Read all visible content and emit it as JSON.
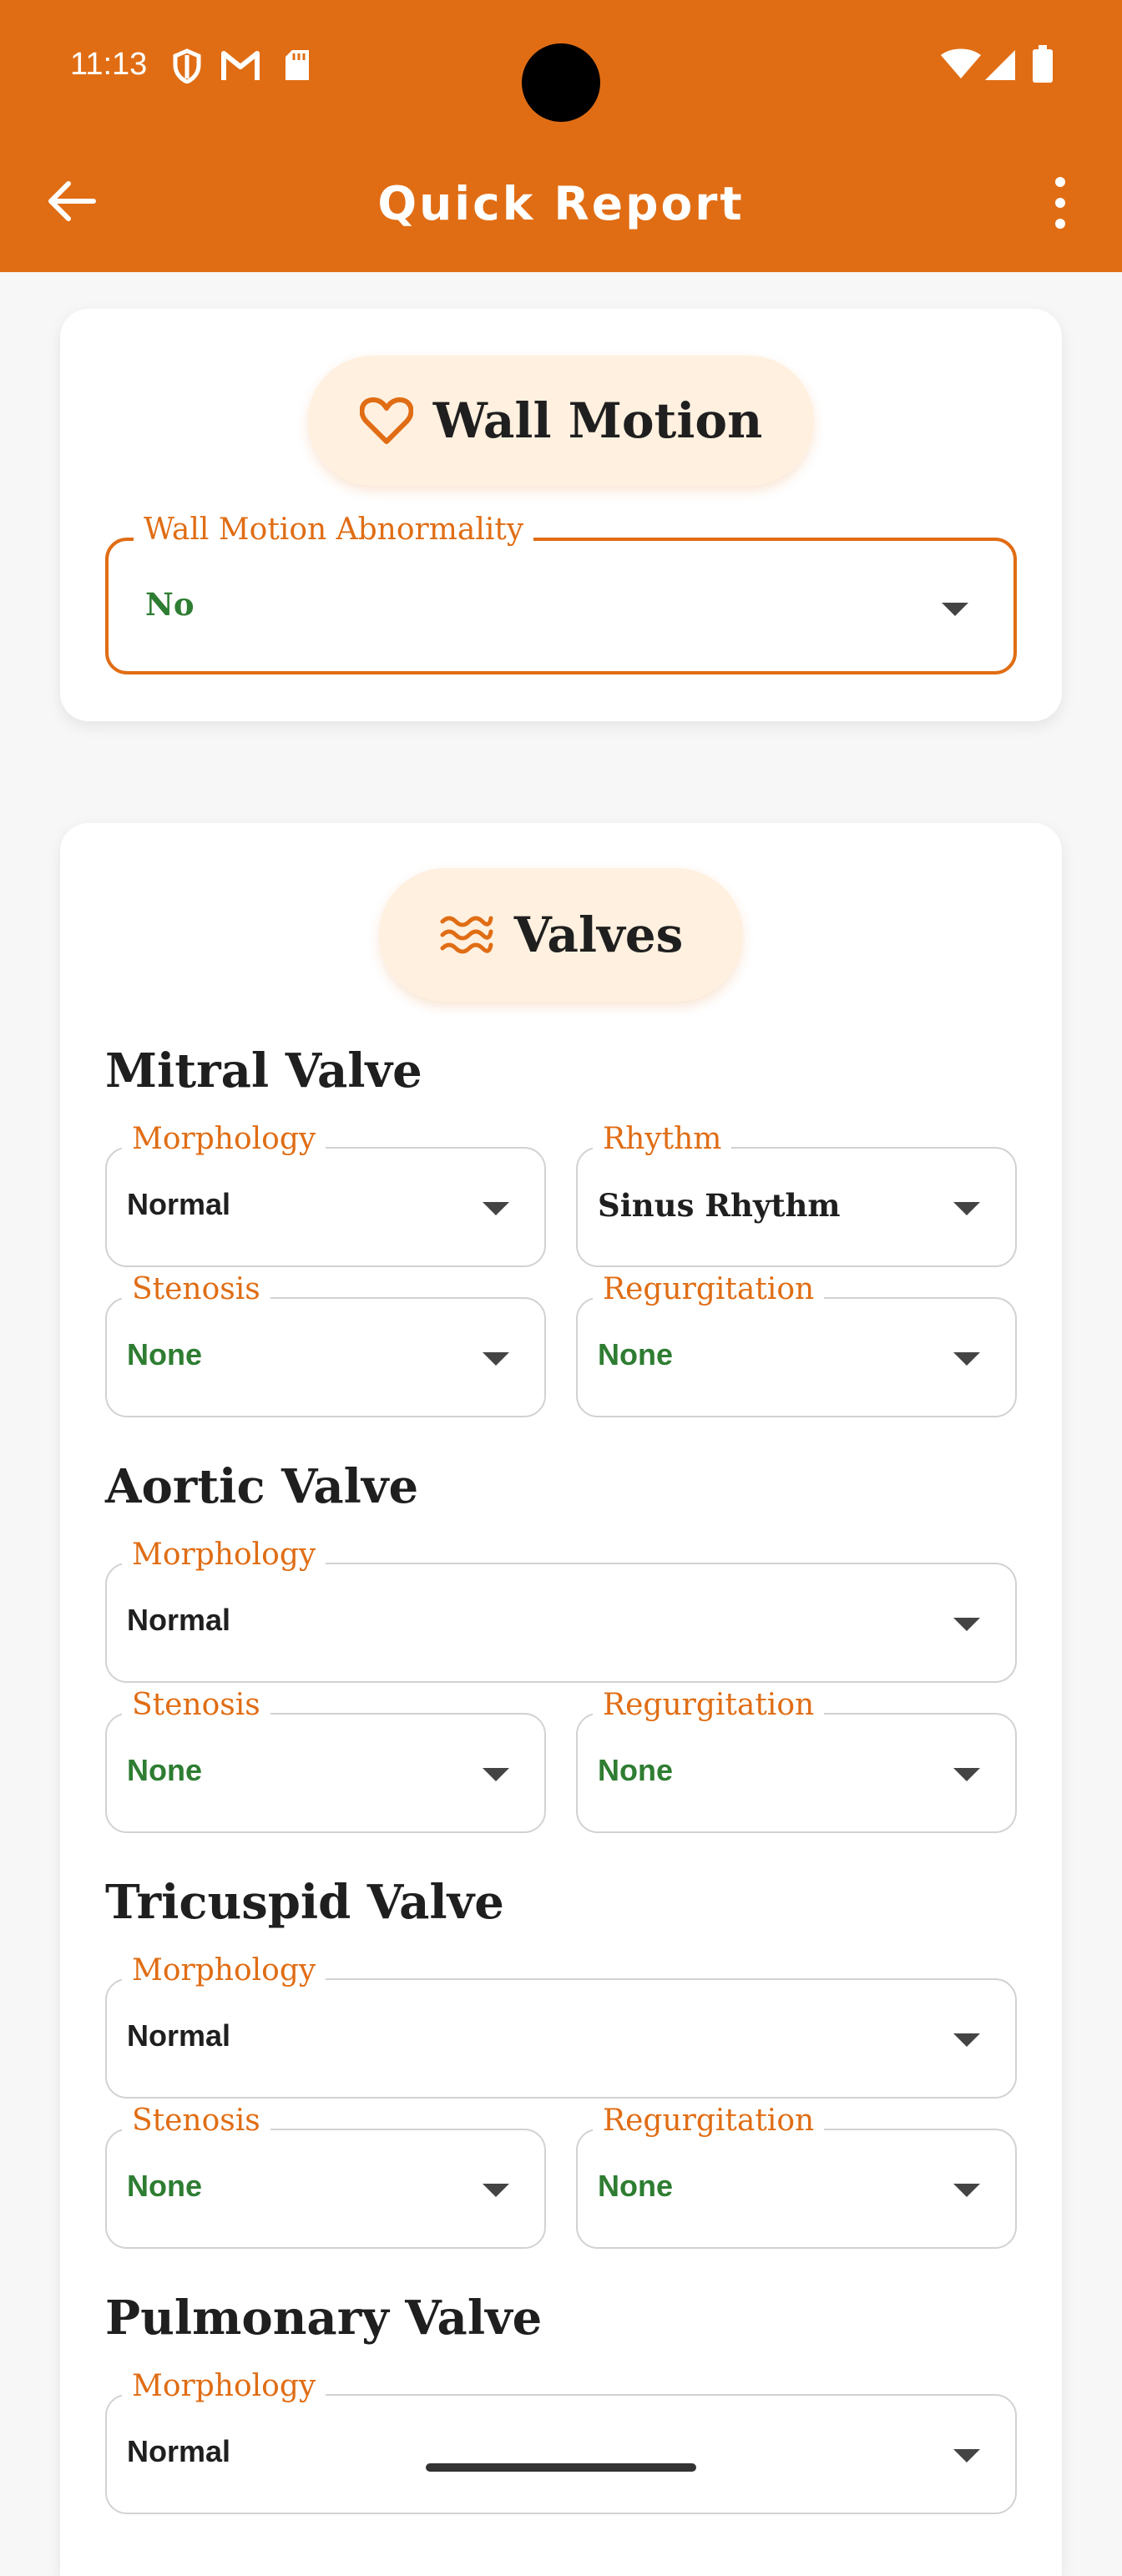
{
  "status_bar": {
    "time": "11:13"
  },
  "app_bar": {
    "title": "Quick Report"
  },
  "wall_motion": {
    "heading": "Wall Motion",
    "field": {
      "label": "Wall Motion Abnormality",
      "value": "No"
    }
  },
  "valves": {
    "heading": "Valves",
    "mitral": {
      "title": "Mitral Valve",
      "morphology": {
        "label": "Morphology",
        "value": "Normal"
      },
      "rhythm": {
        "label": "Rhythm",
        "value": "Sinus Rhythm"
      },
      "stenosis": {
        "label": "Stenosis",
        "value": "None"
      },
      "regurgitation": {
        "label": "Regurgitation",
        "value": "None"
      }
    },
    "aortic": {
      "title": "Aortic Valve",
      "morphology": {
        "label": "Morphology",
        "value": "Normal"
      },
      "stenosis": {
        "label": "Stenosis",
        "value": "None"
      },
      "regurgitation": {
        "label": "Regurgitation",
        "value": "None"
      }
    },
    "tricuspid": {
      "title": "Tricuspid Valve",
      "morphology": {
        "label": "Morphology",
        "value": "Normal"
      },
      "stenosis": {
        "label": "Stenosis",
        "value": "None"
      },
      "regurgitation": {
        "label": "Regurgitation",
        "value": "None"
      }
    },
    "pulmonary": {
      "title": "Pulmonary Valve",
      "morphology": {
        "label": "Morphology",
        "value": "Normal"
      }
    }
  },
  "colors": {
    "accent": "#e06d14",
    "value_green": "#2e7d32",
    "pill_bg": "#fff0df"
  },
  "icons": {
    "back": "arrow-left-icon",
    "menu": "more-vert-icon",
    "wall_motion": "heart-outline-icon",
    "valves": "waves-icon",
    "dropdown": "caret-down-icon"
  }
}
